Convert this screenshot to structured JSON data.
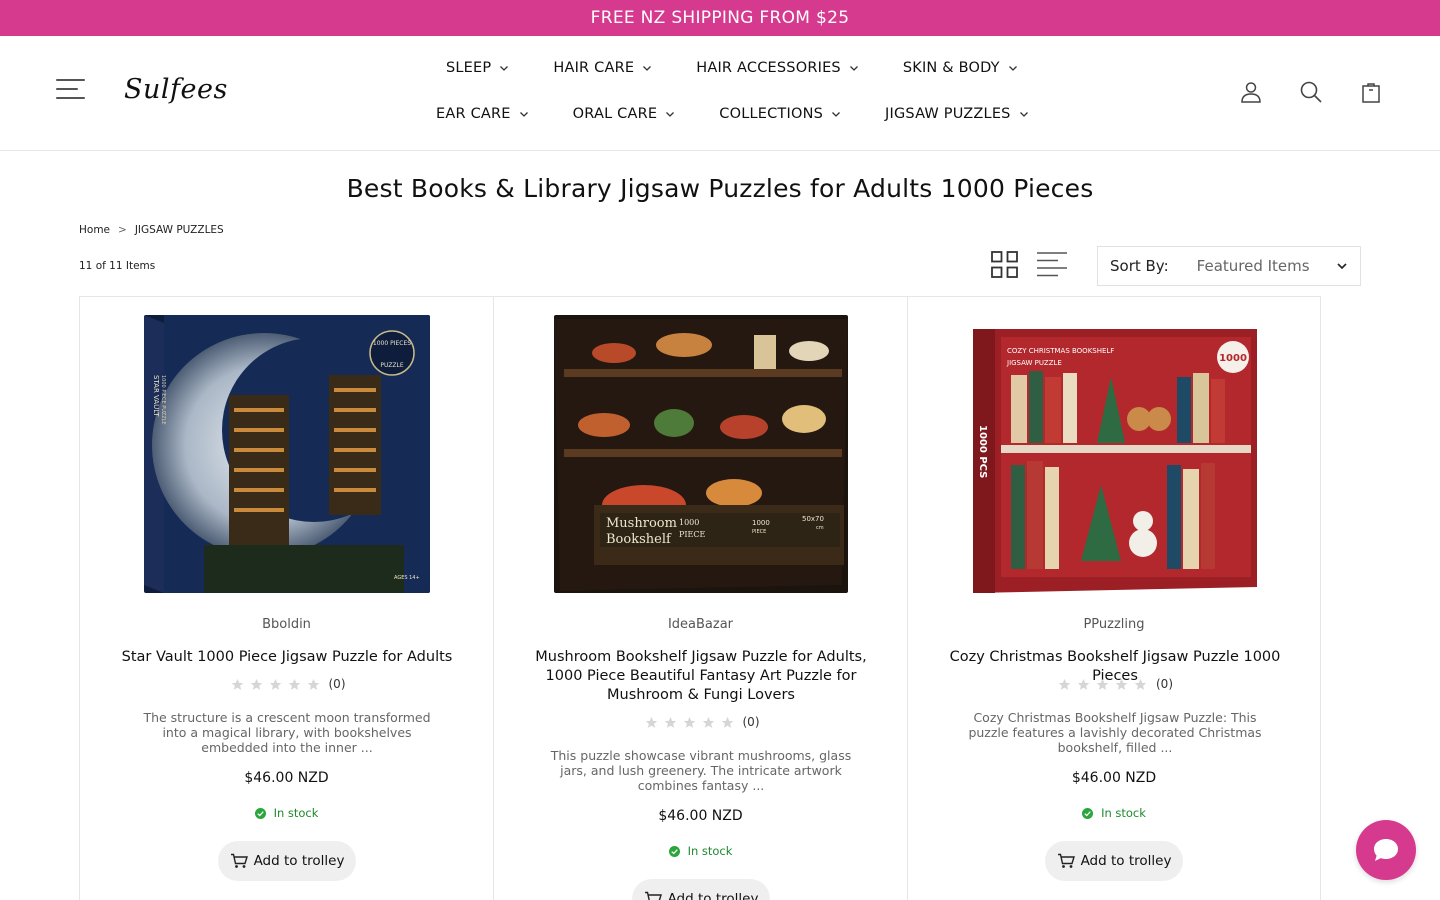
{
  "promo": {
    "text": "FREE NZ SHIPPING FROM $25"
  },
  "header": {
    "logo": "Sulfees",
    "nav_row1": [
      "SLEEP",
      "HAIR CARE",
      "HAIR ACCESSORIES",
      "SKIN & BODY"
    ],
    "nav_row2": [
      "EAR CARE",
      "ORAL CARE",
      "COLLECTIONS",
      "JIGSAW PUZZLES"
    ],
    "icons": [
      "account-icon",
      "search-icon",
      "shopping-bag-icon"
    ]
  },
  "page": {
    "title": "Best Books & Library Jigsaw Puzzles for Adults 1000 Pieces",
    "breadcrumb": {
      "home": "Home",
      "separator": ">",
      "current": "JIGSAW PUZZLES"
    },
    "count": "11 of 11 Items"
  },
  "sort": {
    "label": "Sort By:",
    "value": "Featured Items"
  },
  "colors": {
    "brand": "#d63a8e",
    "in_stock": "#1f8a2e"
  },
  "products": [
    {
      "brand": "Bboldin",
      "name": "Star Vault 1000 Piece Jigsaw Puzzle for Adults",
      "reviews": "(0)",
      "rating": 0,
      "description": "The structure is a crescent moon transformed into a magical library, with bookshelves embedded into the inner ...",
      "price": "$46.00 NZD",
      "stock": "In stock",
      "button": "Add to trolley",
      "image_texts": [
        "1000 PIECES",
        "PUZZLE",
        "STAR VAULT",
        "1000 PIECE PUZZLE",
        "AGES 14+"
      ]
    },
    {
      "brand": "IdeaBazar",
      "name": "Mushroom Bookshelf Jigsaw Puzzle for Adults, 1000 Piece Beautiful Fantasy Art Puzzle for Mushroom & Fungi Lovers",
      "reviews": "(0)",
      "rating": 0,
      "description": "This puzzle showcase vibrant mushrooms, glass jars, and lush greenery. The intricate artwork combines fantasy ...",
      "price": "$46.00 NZD",
      "stock": "In stock",
      "button": "Add to trolley",
      "image_texts": [
        "Mushroom",
        "Bookshelf",
        "1000",
        "PIECE",
        "1000",
        "PIECE",
        "50x70",
        "cm"
      ]
    },
    {
      "brand": "PPuzzling",
      "name": "Cozy Christmas Bookshelf Jigsaw Puzzle 1000 Pieces",
      "reviews": "(0)",
      "rating": 0,
      "description": "Cozy Christmas Bookshelf Jigsaw Puzzle: This puzzle features a lavishly decorated Christmas bookshelf, filled ...",
      "price": "$46.00 NZD",
      "stock": "In stock",
      "button": "Add to trolley",
      "image_texts": [
        "COZY CHRISTMAS BOOKSHELF",
        "JIGSAW PUZZLE",
        "1000",
        "1000 PCS"
      ]
    }
  ]
}
